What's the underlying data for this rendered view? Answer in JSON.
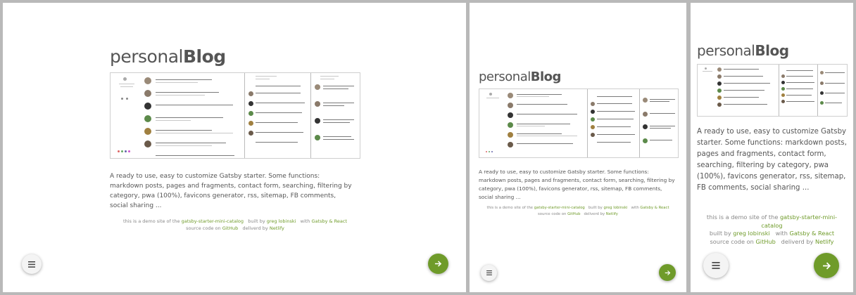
{
  "brand": {
    "light": "personal",
    "bold": "Blog"
  },
  "description": "A ready to use, easy to customize Gatsby starter. Some functions: markdown posts, pages and fragments, contact form, searching, filtering by category, pwa (100%), favicons generator, rss, sitemap, FB comments, social sharing ...",
  "footer": {
    "demo_prefix": "this is a demo site of the",
    "demo_link": "gatsby-starter-mini-catalog",
    "built_by": "built by",
    "author": "greg lobinski",
    "with": "with",
    "tech": "Gatsby & React",
    "source_prefix": "source code on",
    "source_link": "GitHub",
    "delivered": "deliverd by",
    "host": "Netlify"
  },
  "icons": {
    "menu": "menu-icon",
    "next": "arrow-right-icon"
  },
  "colors": {
    "accent": "#6f9b2a",
    "text": "#555555",
    "muted": "#888888"
  }
}
